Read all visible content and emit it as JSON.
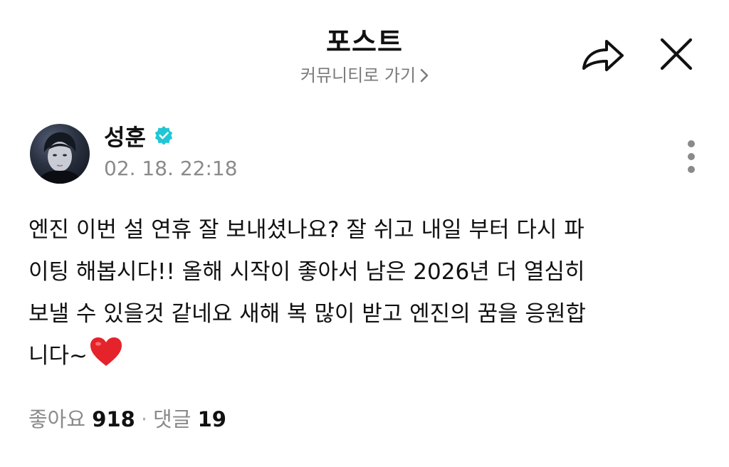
{
  "header": {
    "title": "포스트",
    "community_link": "커뮤니티로 가기"
  },
  "icons": {
    "share": "share-icon",
    "close": "close-icon",
    "more": "more-vertical-icon",
    "verified": "verified-badge-icon",
    "heart": "heart-icon"
  },
  "colors": {
    "verified": "#20C6D6",
    "heart": "#E5232B",
    "muted_text": "#8A8A8A"
  },
  "post": {
    "author": "성훈",
    "date": "02. 18. 22:18",
    "lines": [
      "엔진 이번 설 연휴 잘 보내셨나요? 잘 쉬고 내일 부터 다시 파",
      "이팅 해봅시다!! 올해 시작이 좋아서 남은 2026년 더 열심히",
      "보낼 수 있을것 같네요 새해 복 많이 받고 엔진의 꿈을 응원합",
      "니다~"
    ]
  },
  "stats": {
    "likes_label": "좋아요",
    "likes_count": "918",
    "separator": "·",
    "comments_label": "댓글",
    "comments_count": "19"
  }
}
